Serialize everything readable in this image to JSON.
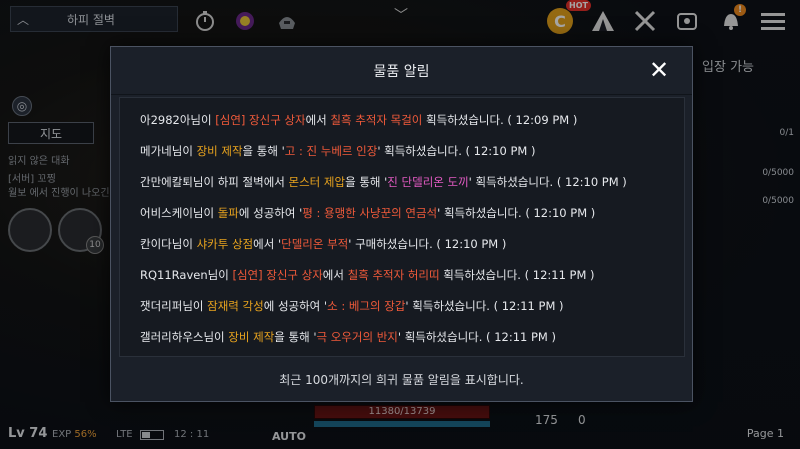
{
  "topbar": {
    "zone_name": "하피 절벽",
    "hot_badge": "HOT",
    "coin_symbol": "C",
    "notify_mark": "!"
  },
  "left": {
    "map_button": "지도",
    "chat_title": "읽지 않은 대화",
    "chat_line1": "[서버] 꼬찡",
    "chat_line2": "월보 에서 진행이 나오긴",
    "badge_number": "10"
  },
  "right": {
    "entry_text": "입장 가능",
    "quest_counter1": "0/1",
    "quest_counter2": "0/5000",
    "quest_counter3": "0/5000"
  },
  "bottom": {
    "level": "Lv 74",
    "exp_label": "EXP",
    "exp_value": "56%",
    "network": "LTE",
    "clock": "12 : 11",
    "auto_label": "AUTO",
    "hp_text": "11380/13739",
    "potion_count": "175",
    "potion_zero": "0",
    "page_label": "Page 1"
  },
  "modal": {
    "title": "물품 알림",
    "close_symbol": "✕",
    "footer": "최근 100개까지의 희귀 물품 알림을 표시합니다.",
    "rows": [
      {
        "segments": [
          {
            "text": "아2982아님이 ",
            "c": ""
          },
          {
            "text": "[심연] 장신구 상자",
            "c": "red"
          },
          {
            "text": "에서 ",
            "c": ""
          },
          {
            "text": "칠흑 추적자 목걸이",
            "c": "red"
          },
          {
            "text": " 획득하셨습니다. ( 12:09 PM )",
            "c": ""
          }
        ]
      },
      {
        "segments": [
          {
            "text": "메가네님이 ",
            "c": ""
          },
          {
            "text": "장비 제작",
            "c": "orange"
          },
          {
            "text": "을 통해 '",
            "c": ""
          },
          {
            "text": "고 : 진 누베르 인장",
            "c": "red"
          },
          {
            "text": "' 획득하셨습니다. ( 12:10 PM )",
            "c": ""
          }
        ]
      },
      {
        "segments": [
          {
            "text": "간만에칼퇴님이 하피 절벽에서 ",
            "c": ""
          },
          {
            "text": "몬스터 제압",
            "c": "orange"
          },
          {
            "text": "을 통해 '",
            "c": ""
          },
          {
            "text": "진 단델리온 도끼",
            "c": "pink"
          },
          {
            "text": "' 획득하셨습니다. ( 12:10 PM )",
            "c": ""
          }
        ]
      },
      {
        "segments": [
          {
            "text": "어비스케이님이 ",
            "c": ""
          },
          {
            "text": "돌파",
            "c": "orange"
          },
          {
            "text": "에 성공하여 '",
            "c": ""
          },
          {
            "text": "평 : 용맹한 사냥꾼의 연금석",
            "c": "red"
          },
          {
            "text": "' 획득하셨습니다. ( 12:10 PM )",
            "c": ""
          }
        ]
      },
      {
        "segments": [
          {
            "text": "칸이다님이 ",
            "c": ""
          },
          {
            "text": "샤카투 상점",
            "c": "orange"
          },
          {
            "text": "에서 '",
            "c": ""
          },
          {
            "text": "단델리온 부적",
            "c": "red"
          },
          {
            "text": "' 구매하셨습니다. ( 12:10 PM )",
            "c": ""
          }
        ]
      },
      {
        "segments": [
          {
            "text": "RQ11Raven님이 ",
            "c": ""
          },
          {
            "text": "[심연] 장신구 상자",
            "c": "red"
          },
          {
            "text": "에서 ",
            "c": ""
          },
          {
            "text": "칠흑 추적자 허리띠",
            "c": "red"
          },
          {
            "text": " 획득하셨습니다. ( 12:11 PM )",
            "c": ""
          }
        ]
      },
      {
        "segments": [
          {
            "text": "잿더리퍼님이 ",
            "c": ""
          },
          {
            "text": "잠재력 각성",
            "c": "orange"
          },
          {
            "text": "에 성공하여 '",
            "c": ""
          },
          {
            "text": "소 : 베그의 장갑",
            "c": "red"
          },
          {
            "text": "' 획득하셨습니다. ( 12:11 PM )",
            "c": ""
          }
        ]
      },
      {
        "segments": [
          {
            "text": "갤러리하우스님이 ",
            "c": ""
          },
          {
            "text": "장비 제작",
            "c": "orange"
          },
          {
            "text": "을 통해 '",
            "c": ""
          },
          {
            "text": "극 오우거의 반지",
            "c": "red"
          },
          {
            "text": "' 획득하셨습니다. ( 12:11 PM )",
            "c": ""
          }
        ]
      }
    ]
  }
}
